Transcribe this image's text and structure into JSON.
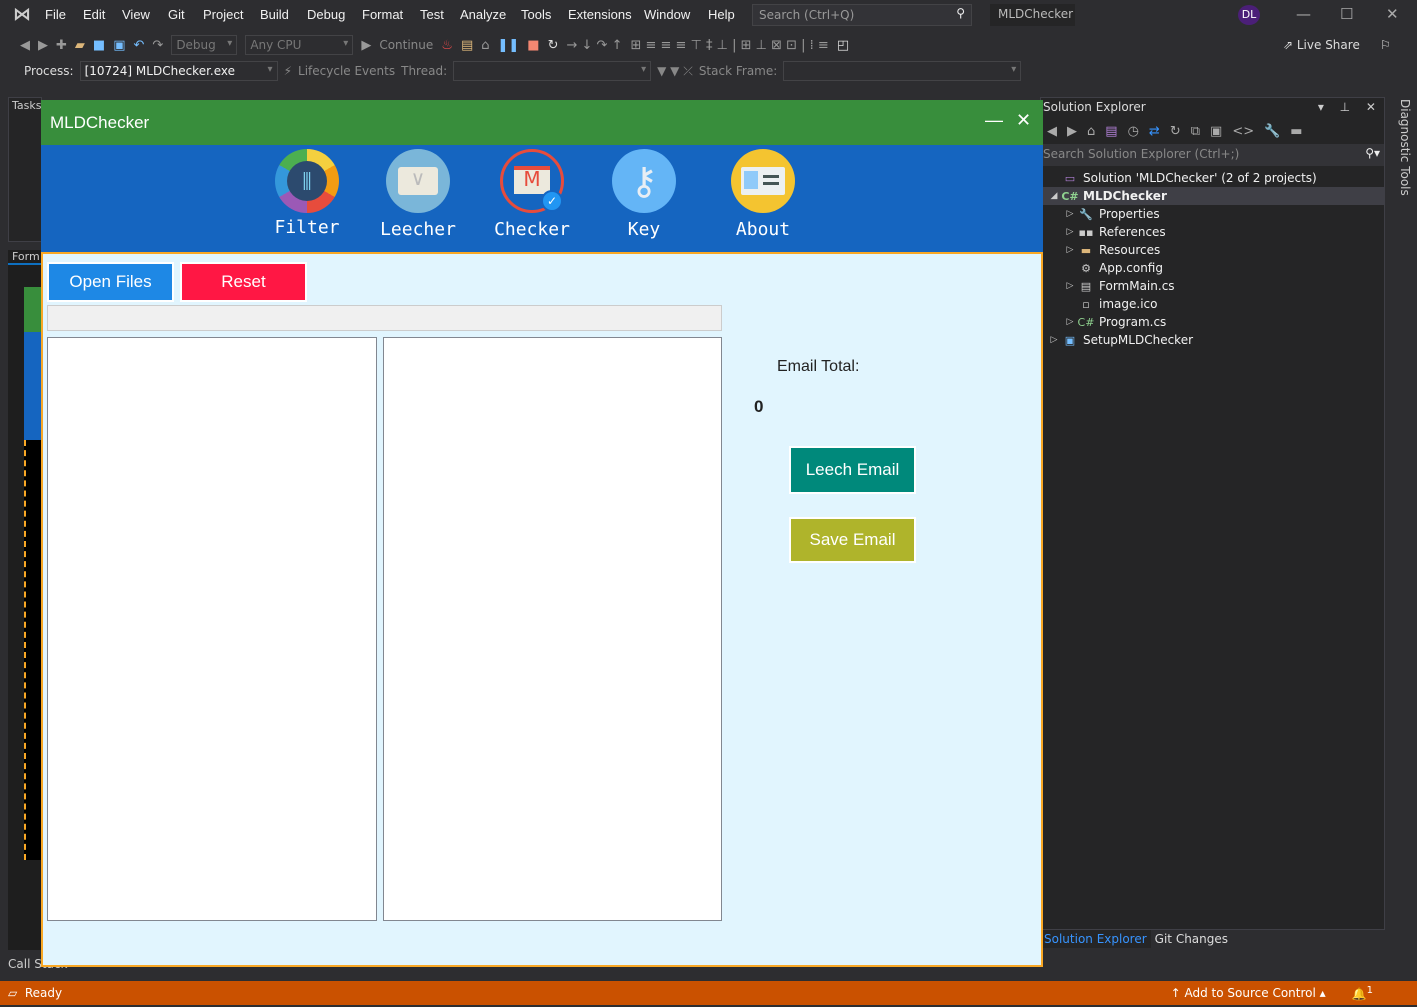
{
  "ide": {
    "menu": [
      "File",
      "Edit",
      "View",
      "Git",
      "Project",
      "Build",
      "Debug",
      "Format",
      "Test",
      "Analyze",
      "Tools",
      "Extensions",
      "Window",
      "Help"
    ],
    "search_placeholder": "Search (Ctrl+Q)",
    "solution_name": "MLDChecker",
    "user_initials": "DL",
    "toolbar": {
      "config": "Debug",
      "platform": "Any CPU",
      "continue": "Continue",
      "live_share": "Live Share"
    },
    "debug_bar": {
      "process_label": "Process:",
      "process_value": "[10724] MLDChecker.exe",
      "lifecycle": "Lifecycle Events",
      "thread_label": "Thread:",
      "stack_frame_label": "Stack Frame:"
    },
    "left_panel": {
      "tasks_tab": "Tasks",
      "form_tab": "Form"
    },
    "bottom_tab": "Call Stack",
    "diagnostic_tools": "Diagnostic Tools",
    "status": {
      "ready": "Ready",
      "source_control": "Add to Source Control",
      "notifications": "1"
    }
  },
  "solution_explorer": {
    "title": "Solution Explorer",
    "search_placeholder": "Search Solution Explorer (Ctrl+;)",
    "tree": [
      {
        "label": "Solution 'MLDChecker' (2 of 2 projects)",
        "icon": "solution-icon",
        "level": 0,
        "toggle": ""
      },
      {
        "label": "MLDChecker",
        "icon": "csharp-project-icon",
        "level": 0,
        "toggle": "◢",
        "selected": true
      },
      {
        "label": "Properties",
        "icon": "wrench-icon",
        "level": 1,
        "toggle": "▷"
      },
      {
        "label": "References",
        "icon": "references-icon",
        "level": 1,
        "toggle": "▷"
      },
      {
        "label": "Resources",
        "icon": "folder-icon",
        "level": 1,
        "toggle": "▷"
      },
      {
        "label": "App.config",
        "icon": "config-file-icon",
        "level": 1,
        "toggle": ""
      },
      {
        "label": "FormMain.cs",
        "icon": "form-icon",
        "level": 1,
        "toggle": "▷"
      },
      {
        "label": "image.ico",
        "icon": "image-file-icon",
        "level": 1,
        "toggle": ""
      },
      {
        "label": "Program.cs",
        "icon": "csharp-file-icon",
        "level": 1,
        "toggle": "▷"
      },
      {
        "label": "SetupMLDChecker",
        "icon": "setup-project-icon",
        "level": 0,
        "toggle": "▷"
      }
    ],
    "tabs": [
      "Solution Explorer",
      "Git Changes"
    ]
  },
  "app": {
    "title": "MLDChecker",
    "nav": [
      {
        "label": "Filter",
        "icon": "filter-sliders-icon"
      },
      {
        "label": "Leecher",
        "icon": "envelope-icon"
      },
      {
        "label": "Checker",
        "icon": "gmail-check-icon"
      },
      {
        "label": "Key",
        "icon": "key-icon"
      },
      {
        "label": "About",
        "icon": "id-card-icon"
      }
    ],
    "open_files": "Open Files",
    "reset": "Reset",
    "progress": 0,
    "email_total_label": "Email Total:",
    "email_total": "0",
    "leech_email": "Leech Email",
    "save_email": "Save Email",
    "colors": {
      "titlebar": "#388e3c",
      "nav": "#1565c0",
      "open": "#1e88e5",
      "reset": "#ff1744",
      "leech": "#00897b",
      "save": "#afb42b",
      "border": "#f9a825"
    }
  }
}
